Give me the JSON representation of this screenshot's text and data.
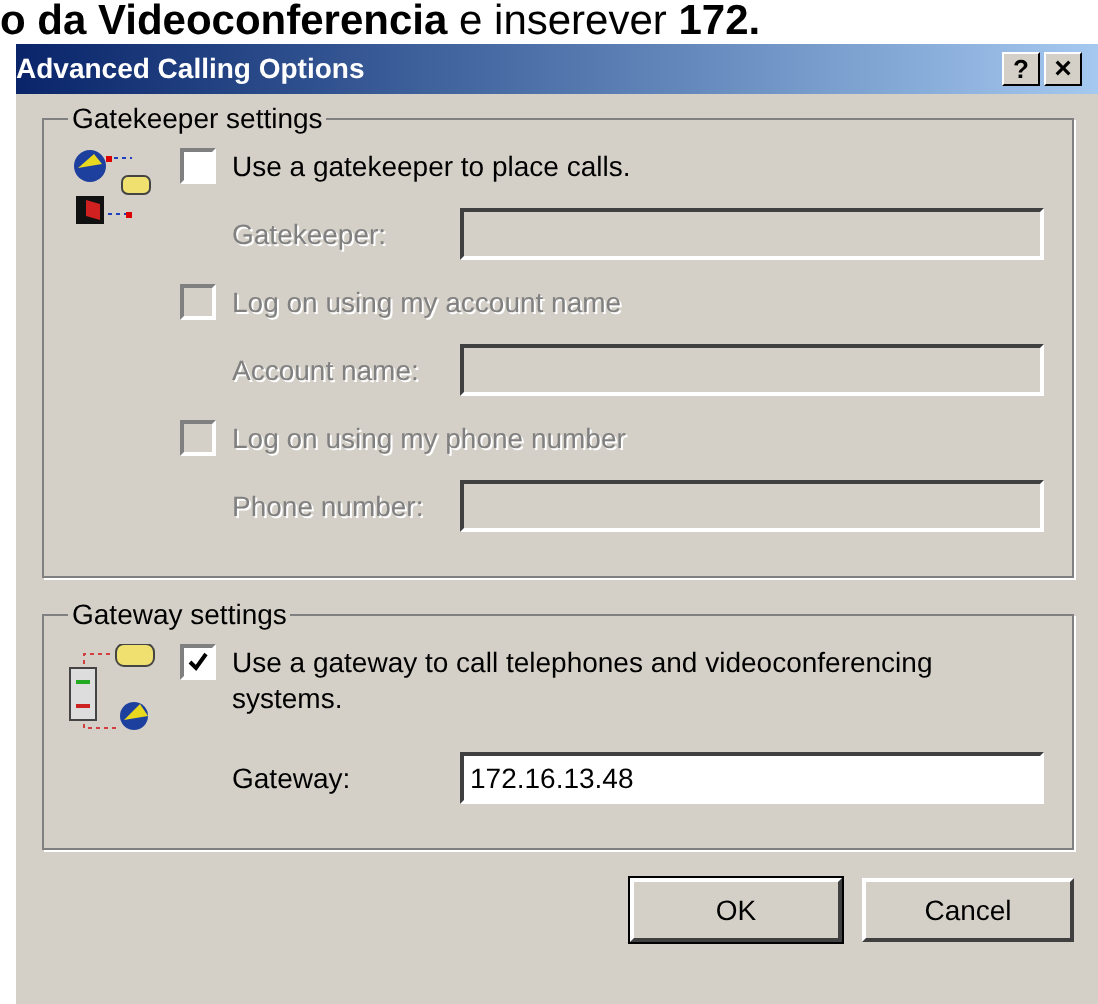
{
  "document_text": "**o da Videoconferencia** e inserever **172.**",
  "window": {
    "title": "Advanced Calling Options",
    "help_button": "?",
    "close_button": "×"
  },
  "groups": [
    {
      "title": "Gatekeeper settings",
      "kind": "network",
      "rows": [
        {
          "kind": "checkbox",
          "label": "Use a gatekeeper to place calls.",
          "checked": false,
          "disabled": false
        },
        {
          "kind": "field",
          "label": "Gatekeeper:",
          "disabled": true
        },
        {
          "kind": "checkbox",
          "label": "Log on using my account name",
          "checked": false,
          "disabled": true
        },
        {
          "kind": "field",
          "label": "Account name:",
          "disabled": true
        },
        {
          "kind": "checkbox",
          "label": "Log on using my phone number",
          "checked": false,
          "disabled": true
        },
        {
          "kind": "field",
          "label": "Phone number:",
          "disabled": true
        }
      ]
    },
    {
      "title": "Gateway settings",
      "kind": "server",
      "rows": [
        {
          "kind": "checkbox",
          "label": "Use a gateway to call telephones and videoconferencing systems.",
          "checked": true,
          "disabled": false
        },
        {
          "kind": "field",
          "label": "Gateway:",
          "value": "172.16.13.48",
          "disabled": false
        }
      ]
    }
  ],
  "buttons": [
    "OK",
    "Cancel"
  ]
}
